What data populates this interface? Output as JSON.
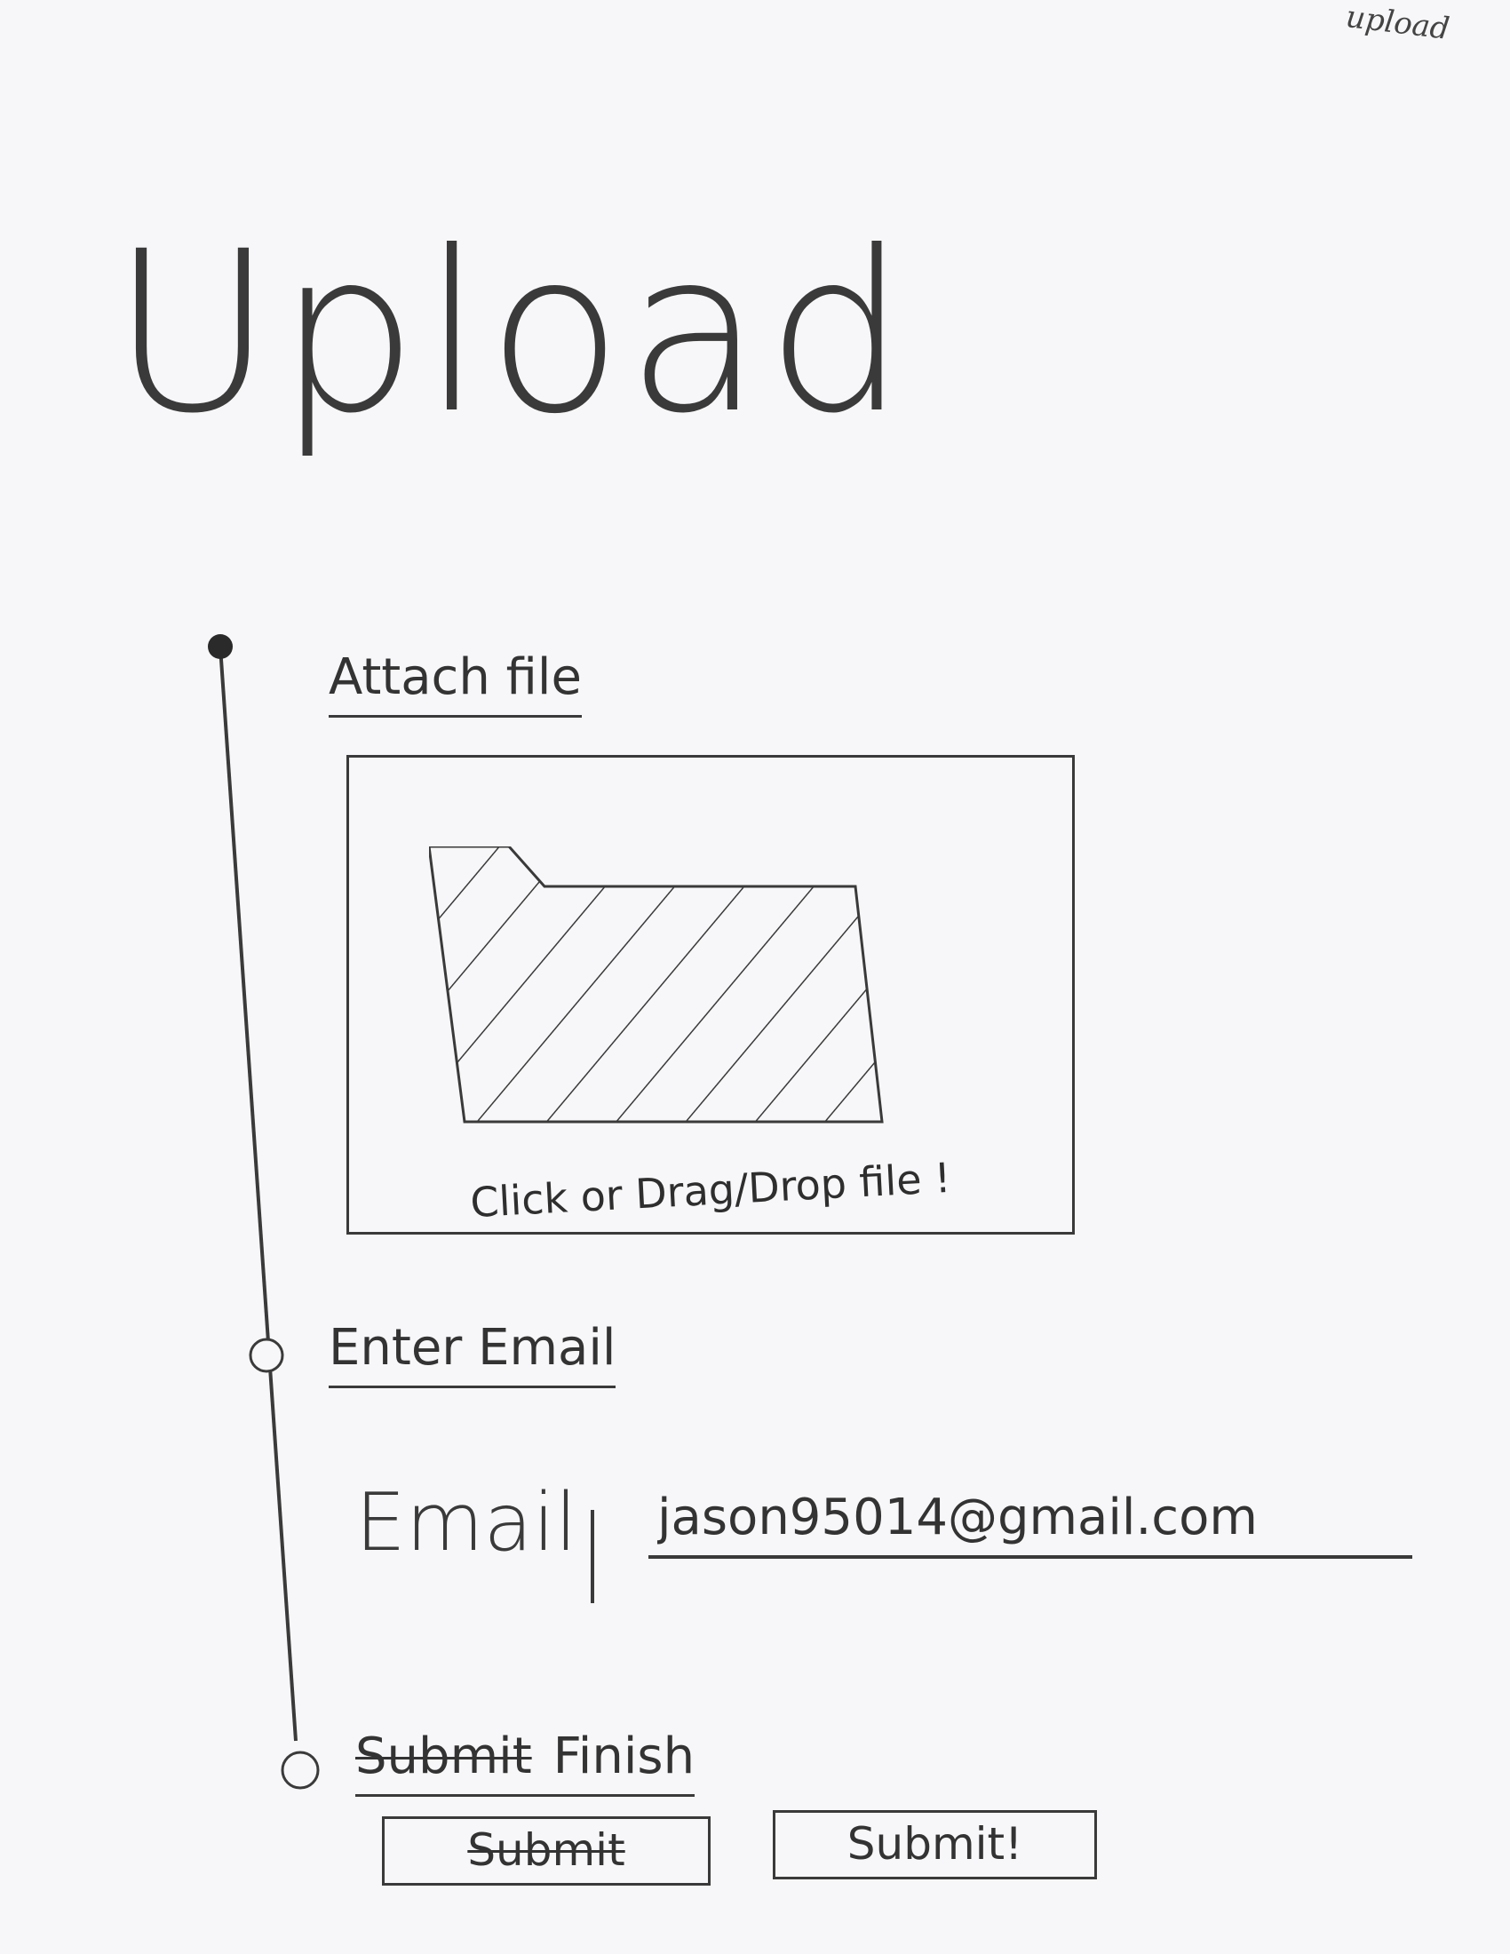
{
  "corner_note": "upload",
  "page_title": "Upload",
  "steps": [
    {
      "label": "Attach file",
      "state": "current"
    },
    {
      "label": "Enter Email",
      "state": "pending"
    },
    {
      "struck_label": "Submit",
      "label": "Finish",
      "state": "pending"
    }
  ],
  "dropzone": {
    "icon": "folder-icon",
    "label": "Click or Drag/Drop file !"
  },
  "email": {
    "label": "Email",
    "value": "jason95014@gmail.com"
  },
  "buttons": {
    "struck": "Submit",
    "submit": "Submit!"
  }
}
